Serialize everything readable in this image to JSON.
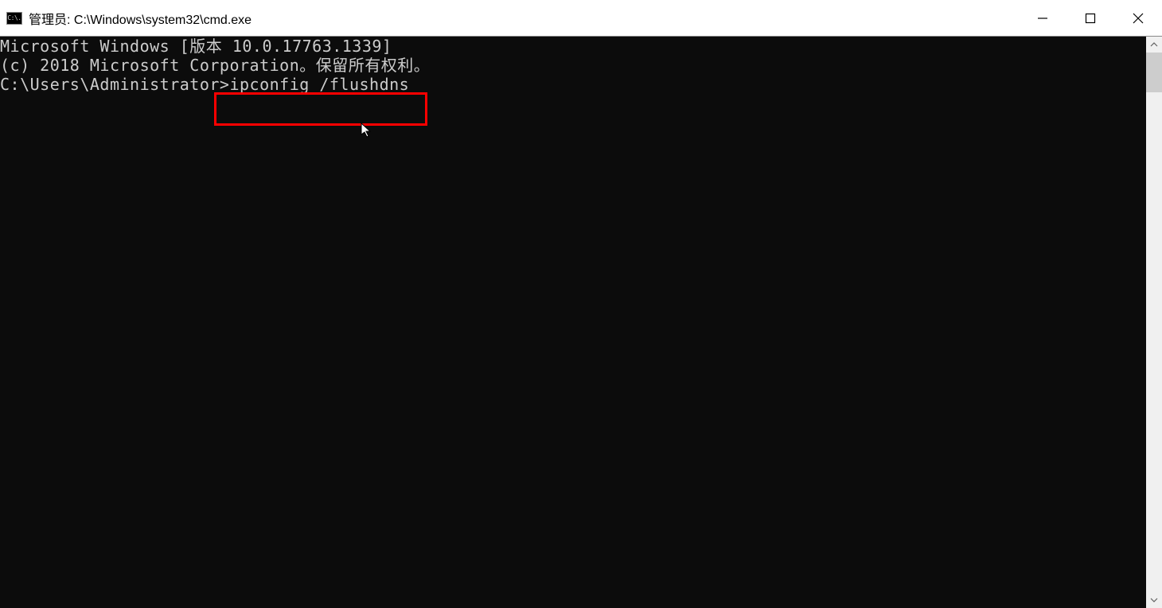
{
  "window": {
    "icon_label": "C:\\.",
    "title": "管理员: C:\\Windows\\system32\\cmd.exe"
  },
  "terminal": {
    "line1": "Microsoft Windows [版本 10.0.17763.1339]",
    "line2": "(c) 2018 Microsoft Corporation。保留所有权利。",
    "blank": "",
    "prompt": "C:\\Users\\Administrator>",
    "command": "ipconfig /flushdns"
  },
  "highlight": {
    "color": "#ff0000"
  }
}
